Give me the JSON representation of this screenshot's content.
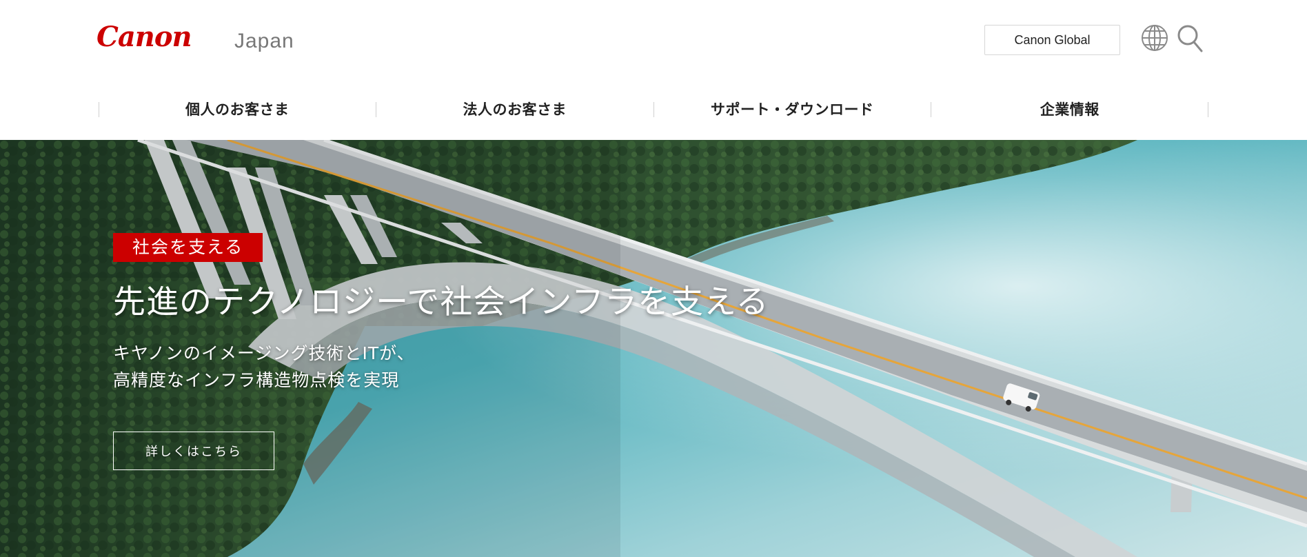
{
  "brand": {
    "logo_text": "Canon",
    "region": "Japan",
    "logo_color": "#cc0000"
  },
  "utility": {
    "global_label": "Canon Global",
    "globe_icon": "globe-icon",
    "search_icon": "search-icon"
  },
  "nav": {
    "items": [
      {
        "label": "個人のお客さま"
      },
      {
        "label": "法人のお客さま"
      },
      {
        "label": "サポート・ダウンロード"
      },
      {
        "label": "企業情報"
      }
    ]
  },
  "hero": {
    "tag": "社会を支える",
    "tag_color": "#cc0000",
    "headline": "先進のテクノロジーで社会インフラを支える",
    "sub_lines": [
      "キヤノンのイメージング技術とITが、",
      "高精度なインフラ構造物点検を実現"
    ],
    "cta_label": "詳しくはこちら"
  }
}
